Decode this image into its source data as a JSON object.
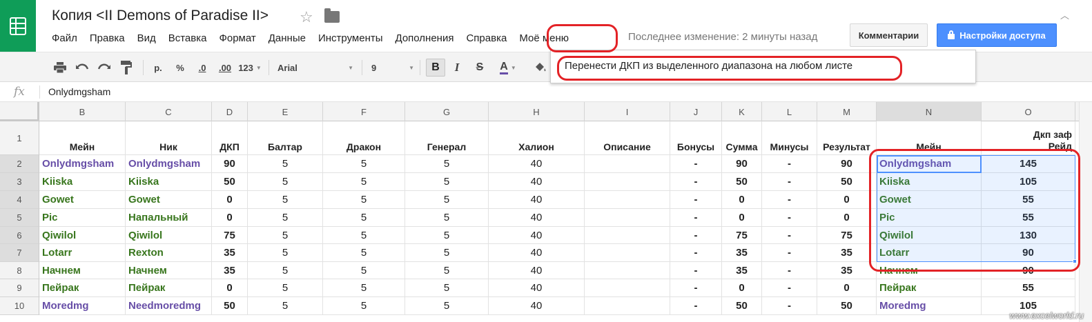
{
  "header": {
    "title": "Копия <II Demons of Paradise II>",
    "last_edit": "Последнее изменение: 2 минуты назад",
    "comments_button": "Комментарии",
    "share_button": "Настройки доступа"
  },
  "menu": [
    "Файл",
    "Правка",
    "Вид",
    "Вставка",
    "Формат",
    "Данные",
    "Инструменты",
    "Дополнения",
    "Справка",
    "Моё меню"
  ],
  "toolbar": {
    "currency": "р.",
    "percent": "%",
    "dec_decrease": ".0",
    "dec_increase": ".00",
    "format_123": "123",
    "font": "Arial",
    "font_size": "9",
    "bold": "B",
    "italic": "I",
    "strike": "S",
    "text_color": "A"
  },
  "dropdown": {
    "item": "Перенести ДКП из выделенного диапазона на любом листе"
  },
  "formula_bar": {
    "fx": "fx",
    "value": "Onlydmgsham"
  },
  "columns": [
    "B",
    "C",
    "D",
    "E",
    "F",
    "G",
    "H",
    "I",
    "J",
    "K",
    "L",
    "M",
    "N",
    "O"
  ],
  "header_row": [
    "Мейн",
    "Ник",
    "ДКП",
    "Балтар",
    "Дракон",
    "Генерал",
    "Халион",
    "Описание",
    "Бонусы",
    "Сумма",
    "Минусы",
    "Результат",
    "Мейн",
    "Дкп заф Рейд"
  ],
  "rows": [
    {
      "num": "1"
    },
    {
      "num": "2",
      "b": "Onlydmgsham",
      "b_color": "#674ea7",
      "c": "Onlydmgsham",
      "c_color": "#674ea7",
      "d": "90",
      "e": "5",
      "f": "5",
      "g": "5",
      "h": "40",
      "j": "-",
      "k": "90",
      "l": "-",
      "m": "90",
      "n": "Onlydmgsham",
      "n_color": "#674ea7",
      "o": "145"
    },
    {
      "num": "3",
      "b": "Kiiska",
      "b_color": "#38761d",
      "c": "Kiiska",
      "c_color": "#38761d",
      "d": "50",
      "e": "5",
      "f": "5",
      "g": "5",
      "h": "40",
      "j": "-",
      "k": "50",
      "l": "-",
      "m": "50",
      "n": "Kiiska",
      "n_color": "#38761d",
      "o": "105"
    },
    {
      "num": "4",
      "b": "Gowet",
      "b_color": "#38761d",
      "c": "Gowet",
      "c_color": "#38761d",
      "d": "0",
      "e": "5",
      "f": "5",
      "g": "5",
      "h": "40",
      "j": "-",
      "k": "0",
      "l": "-",
      "m": "0",
      "n": "Gowet",
      "n_color": "#38761d",
      "o": "55"
    },
    {
      "num": "5",
      "b": "Pic",
      "b_color": "#38761d",
      "c": "Напальный",
      "c_color": "#38761d",
      "d": "0",
      "e": "5",
      "f": "5",
      "g": "5",
      "h": "40",
      "j": "-",
      "k": "0",
      "l": "-",
      "m": "0",
      "n": "Pic",
      "n_color": "#38761d",
      "o": "55"
    },
    {
      "num": "6",
      "b": "Qiwilol",
      "b_color": "#38761d",
      "c": "Qiwilol",
      "c_color": "#38761d",
      "d": "75",
      "e": "5",
      "f": "5",
      "g": "5",
      "h": "40",
      "j": "-",
      "k": "75",
      "l": "-",
      "m": "75",
      "n": "Qiwilol",
      "n_color": "#38761d",
      "o": "130"
    },
    {
      "num": "7",
      "b": "Lotarr",
      "b_color": "#38761d",
      "c": "Rexton",
      "c_color": "#38761d",
      "d": "35",
      "e": "5",
      "f": "5",
      "g": "5",
      "h": "40",
      "j": "-",
      "k": "35",
      "l": "-",
      "m": "35",
      "n": "Lotarr",
      "n_color": "#38761d",
      "o": "90"
    },
    {
      "num": "8",
      "b": "Начнем",
      "b_color": "#38761d",
      "c": "Начнем",
      "c_color": "#38761d",
      "d": "35",
      "e": "5",
      "f": "5",
      "g": "5",
      "h": "40",
      "j": "-",
      "k": "35",
      "l": "-",
      "m": "35",
      "n": "Начнем",
      "n_color": "#38761d",
      "o": "90"
    },
    {
      "num": "9",
      "b": "Пейрак",
      "b_color": "#38761d",
      "c": "Пейрак",
      "c_color": "#38761d",
      "d": "0",
      "e": "5",
      "f": "5",
      "g": "5",
      "h": "40",
      "j": "-",
      "k": "0",
      "l": "-",
      "m": "0",
      "n": "Пейрак",
      "n_color": "#38761d",
      "o": "55"
    },
    {
      "num": "10",
      "b": "Moredmg",
      "b_color": "#674ea7",
      "c": "Needmoredmg",
      "c_color": "#674ea7",
      "d": "50",
      "e": "5",
      "f": "5",
      "g": "5",
      "h": "40",
      "j": "-",
      "k": "50",
      "l": "-",
      "m": "50",
      "n": "Moredmg",
      "n_color": "#674ea7",
      "o": "105"
    }
  ],
  "watermark": "www.excelworld.ru",
  "colors": {
    "brand": "#0f9d58",
    "share": "#4d90fe",
    "annotation": "#e32226",
    "purple_text": "#674ea7",
    "green_text": "#38761d"
  }
}
